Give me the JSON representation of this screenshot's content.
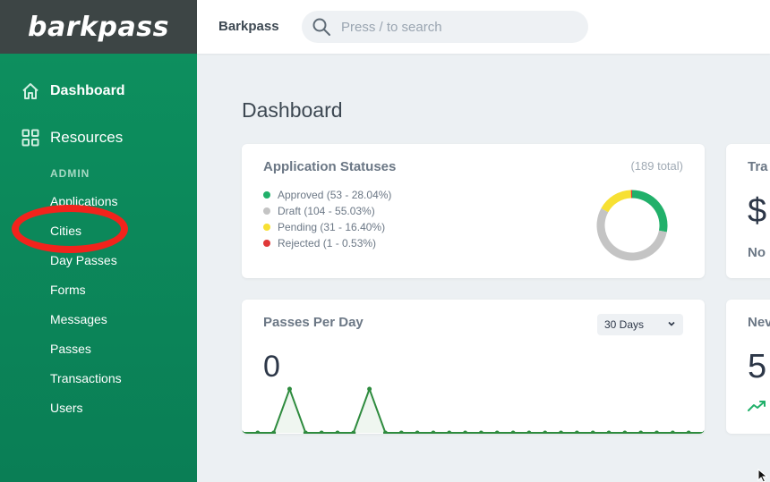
{
  "app": {
    "logo": "barkpass",
    "brand": "Barkpass"
  },
  "search": {
    "placeholder": "Press / to search",
    "icon": "search-icon"
  },
  "sidebar": {
    "main_items": [
      {
        "label": "Dashboard",
        "icon": "home-icon"
      },
      {
        "label": "Resources",
        "icon": "grid-icon"
      }
    ],
    "section_heading": "ADMIN",
    "items": [
      "Applications",
      "Cities",
      "Day Passes",
      "Forms",
      "Messages",
      "Passes",
      "Transactions",
      "Users"
    ]
  },
  "page": {
    "title": "Dashboard"
  },
  "application_statuses": {
    "title": "Application Statuses",
    "total": "(189 total)",
    "legend": [
      {
        "label": "Approved (53 - 28.04%)",
        "color": "#21b06a",
        "value": 53
      },
      {
        "label": "Draft (104 - 55.03%)",
        "color": "#c4c4c4",
        "value": 104
      },
      {
        "label": "Pending (31 - 16.40%)",
        "color": "#f7e033",
        "value": 31
      },
      {
        "label": "Rejected (1 - 0.53%)",
        "color": "#e03838",
        "value": 1
      }
    ]
  },
  "passes_per_day": {
    "title": "Passes Per Day",
    "range": "30 Days",
    "value": "0"
  },
  "chart_data": {
    "type": "area",
    "title": "Passes Per Day",
    "x": [
      1,
      2,
      3,
      4,
      5,
      6,
      7,
      8,
      9,
      10,
      11,
      12,
      13,
      14,
      15,
      16,
      17,
      18,
      19,
      20,
      21,
      22,
      23,
      24,
      25,
      26,
      27,
      28,
      29,
      30
    ],
    "series": [
      {
        "values": [
          0,
          0,
          0,
          1,
          0,
          0,
          0,
          0,
          1,
          0,
          0,
          0,
          0,
          0,
          0,
          0,
          0,
          0,
          0,
          0,
          0,
          0,
          0,
          0,
          0,
          0,
          0,
          0,
          0,
          0
        ],
        "color": "#2e8b3e"
      }
    ],
    "grid": false
  },
  "right_cards": {
    "card1": {
      "title": "Tra",
      "value": "$",
      "sub": "No"
    },
    "card2": {
      "title": "Nev",
      "value": "5"
    }
  },
  "colors": {
    "accent": "#0d8f5e",
    "annotation": "#f2231c"
  }
}
